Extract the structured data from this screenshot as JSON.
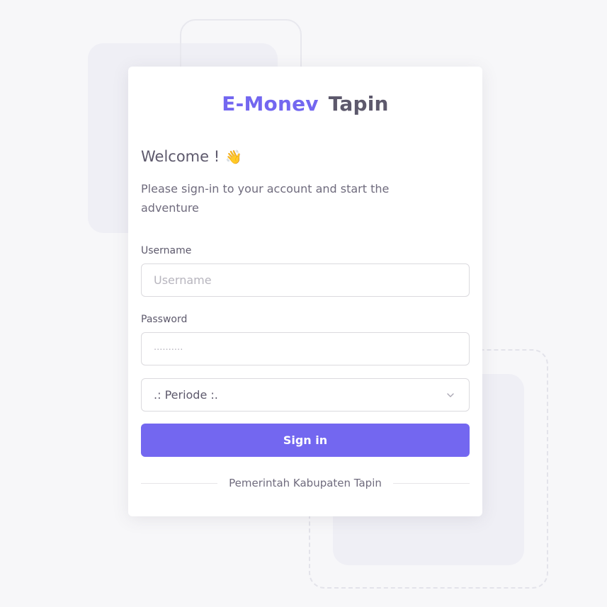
{
  "brand": {
    "name": "E-Monev",
    "suffix": "Tapin",
    "accent_color": "#7367f0"
  },
  "welcome": {
    "title": "Welcome !",
    "emoji": "👋",
    "subtitle": "Please sign-in to your account and start the adventure"
  },
  "form": {
    "username_label": "Username",
    "username_placeholder": "Username",
    "username_value": "",
    "password_label": "Password",
    "password_placeholder": "··········",
    "password_value": "",
    "periode_selected": ".: Periode :.",
    "submit_label": "Sign in"
  },
  "footer": {
    "divider_text": "Pemerintah Kabupaten Tapin"
  },
  "icons": {
    "select_chevron": "chevron-down-icon",
    "welcome_emoji": "waving-hand-icon"
  }
}
